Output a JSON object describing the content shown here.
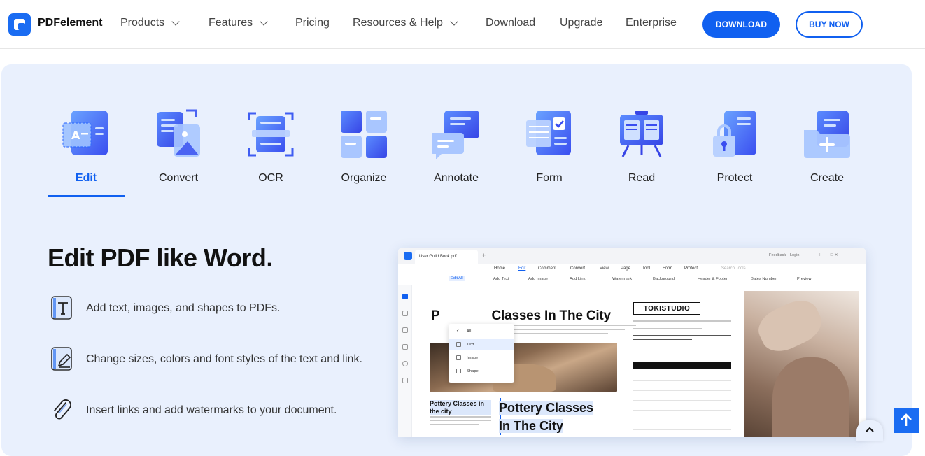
{
  "nav": {
    "brand": "PDFelement",
    "items": [
      {
        "label": "Products",
        "dropdown": true
      },
      {
        "label": "Features",
        "dropdown": true
      },
      {
        "label": "Pricing",
        "dropdown": false
      },
      {
        "label": "Resources & Help",
        "dropdown": true
      },
      {
        "label": "Download",
        "dropdown": false
      },
      {
        "label": "Upgrade",
        "dropdown": false
      },
      {
        "label": "Enterprise",
        "dropdown": false
      }
    ],
    "download_label": "DOWNLOAD",
    "buy_label": "BUY NOW"
  },
  "tabs": {
    "active": "Edit",
    "items": [
      {
        "label": "Edit",
        "icon": "edit-icon"
      },
      {
        "label": "Convert",
        "icon": "convert-icon"
      },
      {
        "label": "OCR",
        "icon": "ocr-icon"
      },
      {
        "label": "Organize",
        "icon": "organize-icon"
      },
      {
        "label": "Annotate",
        "icon": "annotate-icon"
      },
      {
        "label": "Form",
        "icon": "form-icon"
      },
      {
        "label": "Read",
        "icon": "read-icon"
      },
      {
        "label": "Protect",
        "icon": "protect-icon"
      },
      {
        "label": "Create",
        "icon": "create-icon"
      }
    ]
  },
  "content": {
    "headline": "Edit PDF like Word.",
    "features": [
      {
        "text": "Add text, images, and shapes to PDFs.",
        "icon": "text-box-icon"
      },
      {
        "text": "Change sizes, colors and font styles of the text and link.",
        "icon": "edit-pencil-icon"
      },
      {
        "text": "Insert links and add watermarks to your document.",
        "icon": "paperclip-icon"
      }
    ]
  },
  "app": {
    "tab_name": "User Guild Book.pdf",
    "titlebar_right": [
      "Feedback",
      "Login"
    ],
    "menu": [
      "Home",
      "Edit",
      "Comment",
      "Convert",
      "View",
      "Page",
      "Tool",
      "Form",
      "Protect"
    ],
    "menu_active": "Edit",
    "search_placeholder": "Search Tools",
    "toolbar": [
      "Edit All",
      "Add Text",
      "Add Image",
      "Add Link",
      "Watermark",
      "Background",
      "Header & Footer",
      "Bates Number",
      "Preview"
    ],
    "dropdown": [
      "All",
      "Text",
      "Image",
      "Shape"
    ],
    "dropdown_selected": "Text",
    "doc_heading": "Classes In The City",
    "doc_heading_prefix": "P",
    "studio_name": "TOKISTUDIO",
    "small_title": "Pottery Classes in the city",
    "big_title_line1": "Pottery Classes",
    "big_title_line2": "In The City"
  },
  "colors": {
    "accent": "#1060f0",
    "panel_bg": "#e9f0fd"
  }
}
